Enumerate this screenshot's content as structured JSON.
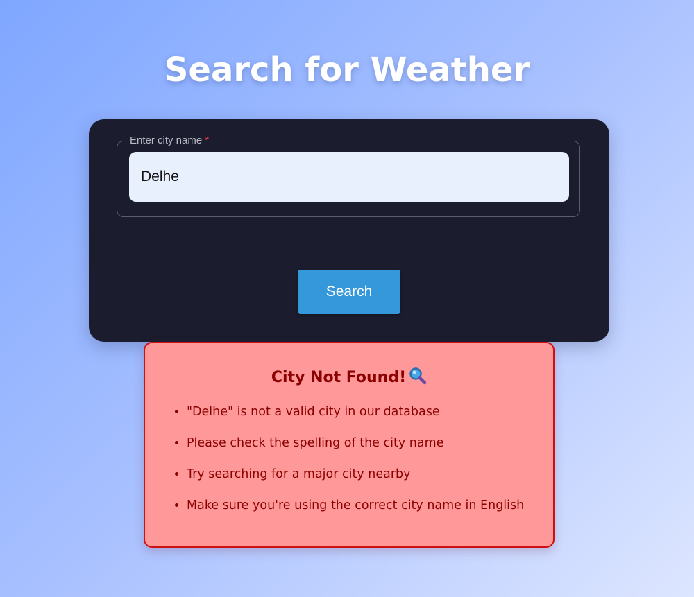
{
  "header": {
    "title": "Search for Weather"
  },
  "search_form": {
    "field_label": "Enter city name",
    "required_marker": "*",
    "input_value": "Delhe",
    "button_label": "Search"
  },
  "error": {
    "title": "City Not Found!",
    "title_icon": "magnifying-glass-icon",
    "messages": [
      "\"Delhe\" is not a valid city in our database",
      "Please check the spelling of the city name",
      "Try searching for a major city nearby",
      "Make sure you're using the correct city name in English"
    ]
  },
  "colors": {
    "card_background": "#1b1c2e",
    "button": "#3498db",
    "error_background": "#ff9999",
    "error_border": "#d01010",
    "error_text": "#8b0000"
  }
}
